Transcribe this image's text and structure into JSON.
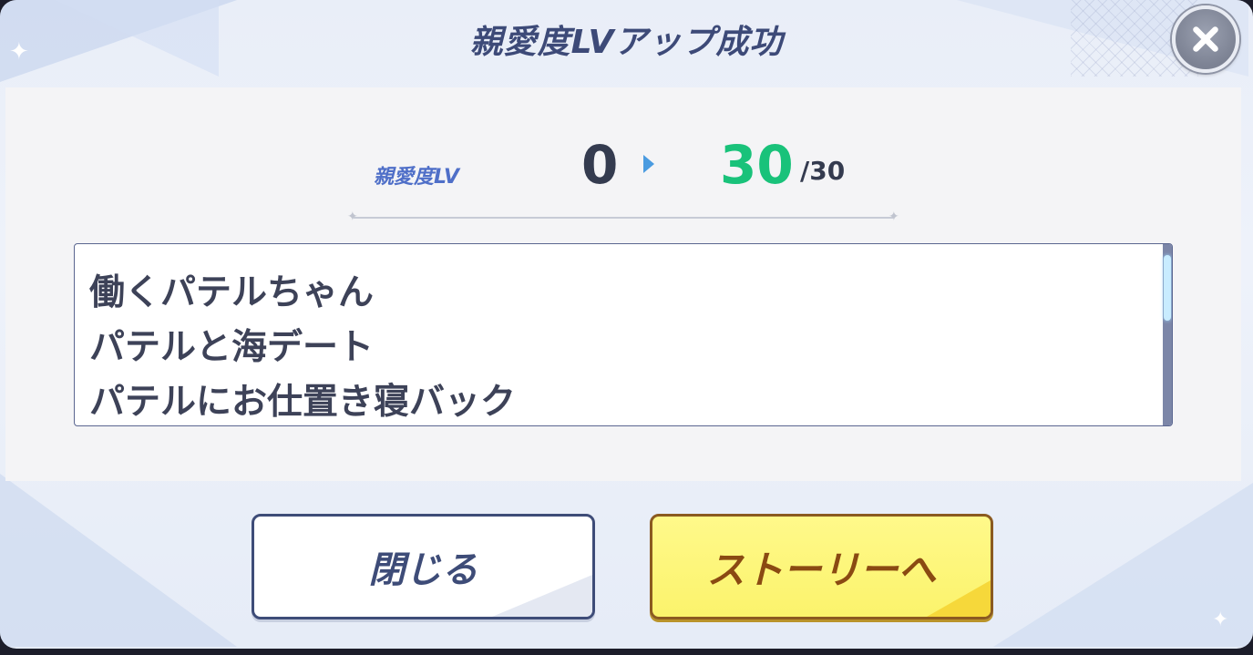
{
  "dialog": {
    "title": "親愛度LVアップ成功",
    "close_icon": "close-x-icon"
  },
  "level": {
    "label": "親愛度LV",
    "from": "0",
    "to": "30",
    "max": "/30",
    "to_color": "#19c27a"
  },
  "stories": [
    "働くパテルちゃん",
    "パテルと海デート",
    "パテルにお仕置き寝バック"
  ],
  "buttons": {
    "close_label": "閉じる",
    "story_label": "ストーリーへ"
  },
  "colors": {
    "title_text": "#3d4a78",
    "story_button_bg": "#fbf36c",
    "story_button_text": "#8a4a12"
  }
}
